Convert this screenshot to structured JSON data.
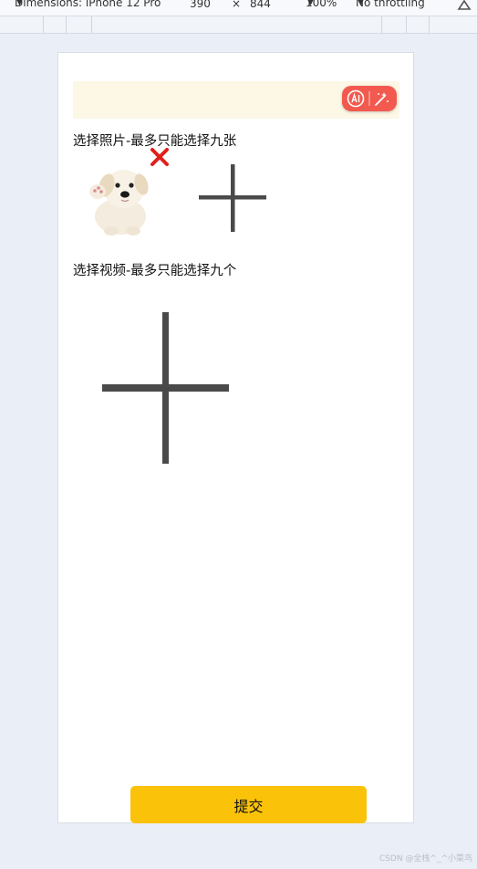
{
  "devtools": {
    "dimensions_label": "Dimensions: iPhone 12 Pro",
    "width_value": "390",
    "times_symbol": "×",
    "height_value": "844",
    "zoom": "100%",
    "throttling": "No throttling"
  },
  "photo_section": {
    "title": "选择照片-最多只能选择九张"
  },
  "video_section": {
    "title": "选择视频-最多只能选择九个"
  },
  "submit": {
    "label": "提交",
    "color": "#fbc20a"
  },
  "watermark": "CSDN @全栈^_^小菜鸟",
  "icons": {
    "add_photo": "plus-icon",
    "add_video": "plus-icon",
    "delete_photo": "close-icon",
    "ai": "ai-icon",
    "magic_wand": "magic-wand-icon"
  },
  "colors": {
    "accent_red": "#f25a4f",
    "banner_bg": "#fdf7e6",
    "delete_red": "#e0201b",
    "plus_gray": "#4a4a4a"
  }
}
